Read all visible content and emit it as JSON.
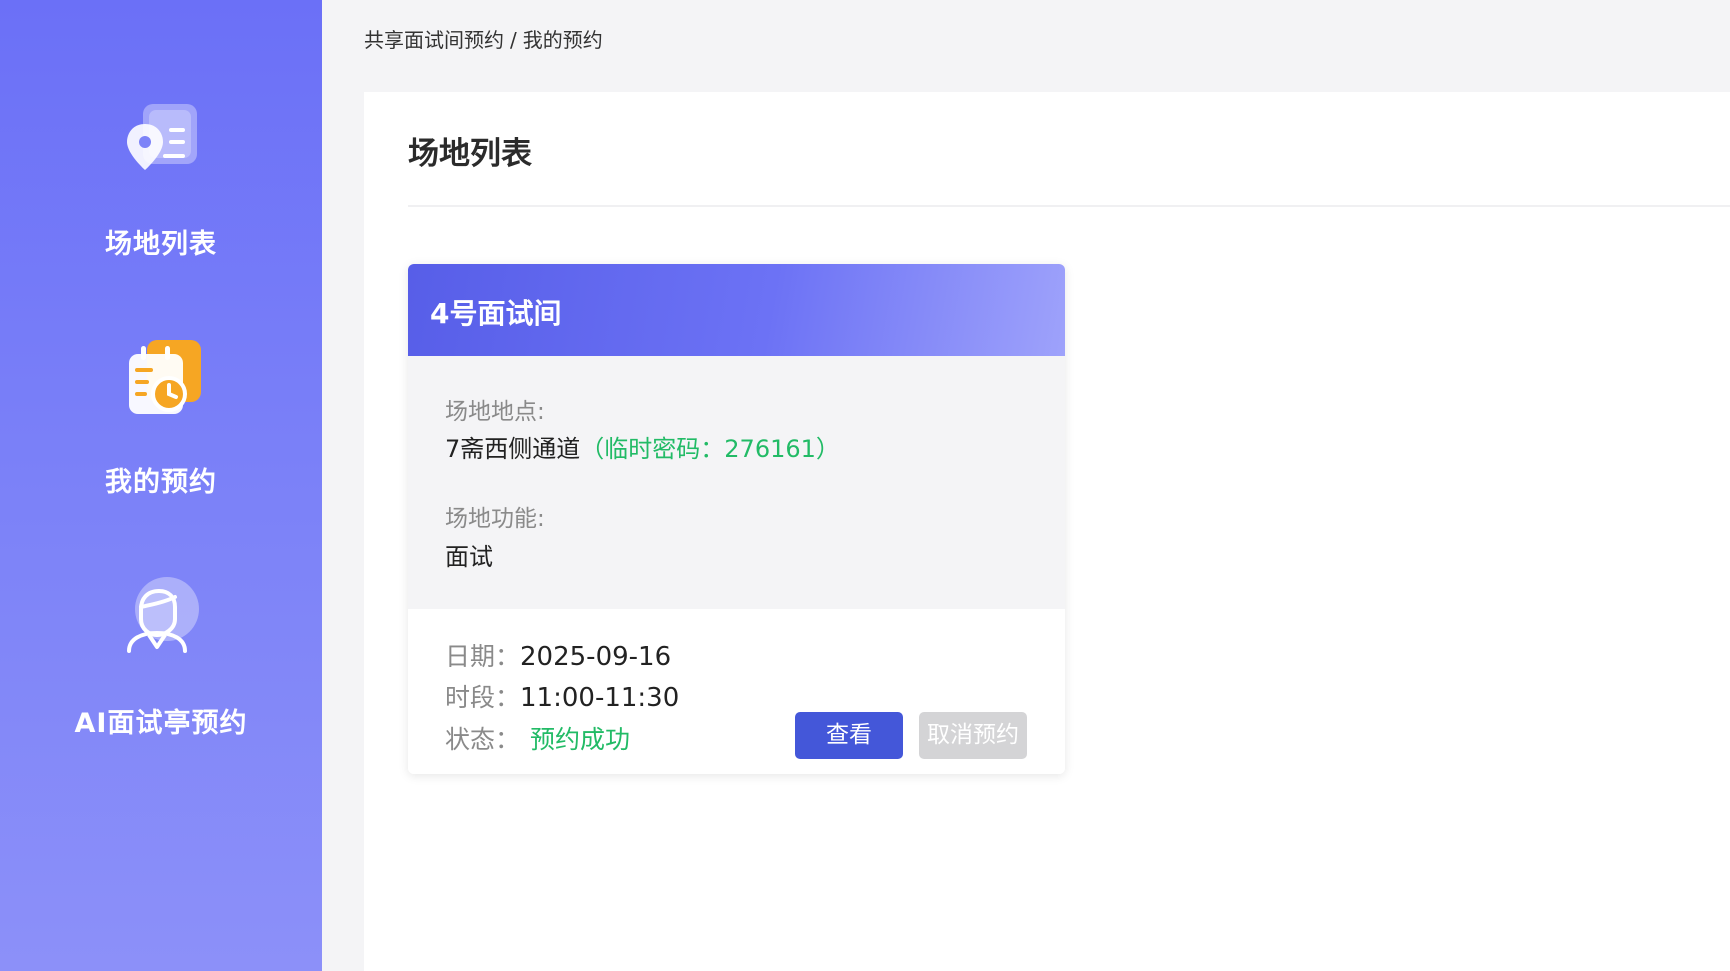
{
  "sidebar": {
    "items": [
      {
        "label": "场地列表",
        "icon": "venue-list-icon"
      },
      {
        "label": "我的预约",
        "icon": "calendar-clock-icon"
      },
      {
        "label": "AI面试亭预约",
        "icon": "ai-interviewer-icon"
      }
    ]
  },
  "breadcrumb": {
    "parent": "共享面试间预约",
    "separator": "/",
    "current": "我的预约"
  },
  "panel": {
    "title": "场地列表"
  },
  "card": {
    "title": "4号面试间",
    "location_label": "场地地点:",
    "location_value": "7斋西侧通道",
    "temp_password": "（临时密码：276161）",
    "function_label": "场地功能:",
    "function_value": "面试",
    "date_label": "日期：",
    "date_value": "2025-09-16",
    "slot_label": "时段：",
    "slot_value": "11:00-11:30",
    "status_label": "状态：",
    "status_value": "预约成功",
    "view_button": "查看",
    "cancel_button": "取消预约"
  },
  "colors": {
    "sidebar_top": "#6b70f7",
    "sidebar_bottom": "#8c90f9",
    "accent_button": "#4457d9",
    "success_green": "#22bb66",
    "disabled_button": "#d4d4d6"
  }
}
